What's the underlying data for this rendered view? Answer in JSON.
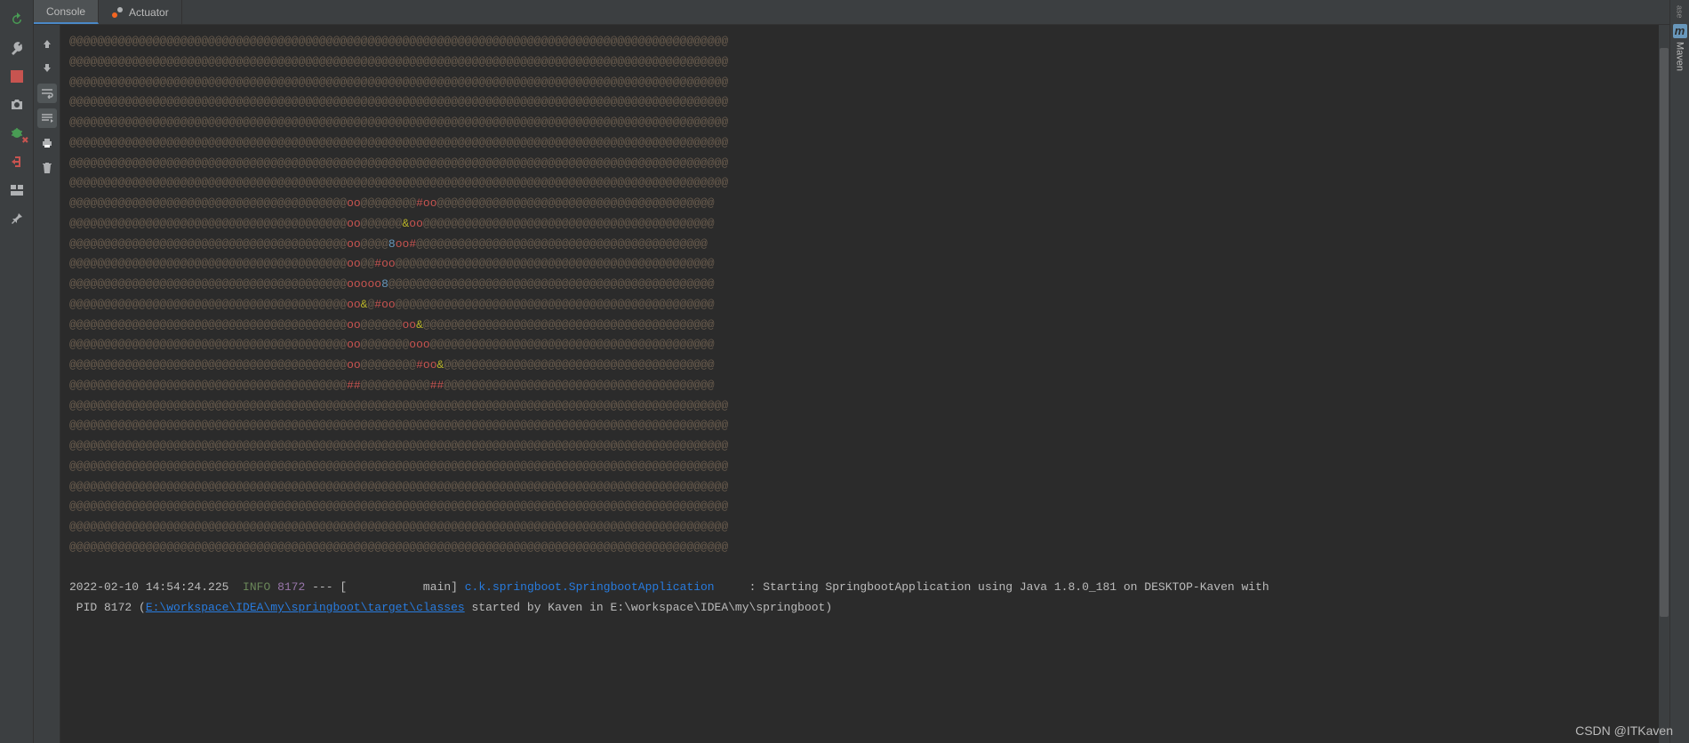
{
  "tabs": {
    "console": "Console",
    "actuator": "Actuator"
  },
  "right_sidebar": {
    "maven": "Maven",
    "small": "ase"
  },
  "log": {
    "timestamp": "2022-02-10 14:54:24.225",
    "level": "INFO",
    "pid": "8172",
    "sep": "--- [",
    "thread": "           main]",
    "logger": "c.k.springboot.SpringbootApplication",
    "colon": "     : ",
    "msg1": "Starting SpringbootApplication using Java 1.8.0_181 on DESKTOP-Kaven with",
    "msg2a": " PID 8172 (",
    "link": "E:\\workspace\\IDEA\\my\\springboot\\target\\classes",
    "msg2b": " started by Kaven in E:\\workspace\\IDEA\\my\\springboot)"
  },
  "banner": {
    "plain_row": "@@@@@@@@@@@@@@@@@@@@@@@@@@@@@@@@@@@@@@@@@@@@@@@@@@@@@@@@@@@@@@@@@@@@@@@@@@@@@@@@@@@@@@@@@@@@@@@",
    "colored": [
      {
        "pre": "@@@@@@@@@@@@@@@@@@@@@@@@@@@@@@@@@@@@@@@@",
        "seq": [
          {
            "t": "oo",
            "c": "oo"
          },
          {
            "t": "ba",
            "c": "@@@@@@@@"
          },
          {
            "t": "hash",
            "c": "#"
          },
          {
            "t": "oo",
            "c": "oo"
          }
        ],
        "post": "@@@@@@@@@@@@@@@@@@@@@@@@@@@@@@@@@@@@@@@@"
      },
      {
        "pre": "@@@@@@@@@@@@@@@@@@@@@@@@@@@@@@@@@@@@@@@@",
        "seq": [
          {
            "t": "oo",
            "c": "oo"
          },
          {
            "t": "ba",
            "c": "@@@@@@"
          },
          {
            "t": "amp",
            "c": "&"
          },
          {
            "t": "oo",
            "c": "oo"
          }
        ],
        "post": "@@@@@@@@@@@@@@@@@@@@@@@@@@@@@@@@@@@@@@@@@@"
      },
      {
        "pre": "@@@@@@@@@@@@@@@@@@@@@@@@@@@@@@@@@@@@@@@@",
        "seq": [
          {
            "t": "oo",
            "c": "oo"
          },
          {
            "t": "ba",
            "c": "@@@@"
          },
          {
            "t": "num",
            "c": "8"
          },
          {
            "t": "oo",
            "c": "oo"
          },
          {
            "t": "hash",
            "c": "#"
          }
        ],
        "post": "@@@@@@@@@@@@@@@@@@@@@@@@@@@@@@@@@@@@@@@@@@"
      },
      {
        "pre": "@@@@@@@@@@@@@@@@@@@@@@@@@@@@@@@@@@@@@@@@",
        "seq": [
          {
            "t": "oo",
            "c": "oo"
          },
          {
            "t": "ba",
            "c": "@@"
          },
          {
            "t": "hash",
            "c": "#"
          },
          {
            "t": "oo",
            "c": "oo"
          }
        ],
        "post": "@@@@@@@@@@@@@@@@@@@@@@@@@@@@@@@@@@@@@@@@@@@@@@"
      },
      {
        "pre": "@@@@@@@@@@@@@@@@@@@@@@@@@@@@@@@@@@@@@@@@",
        "seq": [
          {
            "t": "oo",
            "c": "ooooo"
          },
          {
            "t": "num",
            "c": "8"
          }
        ],
        "post": "@@@@@@@@@@@@@@@@@@@@@@@@@@@@@@@@@@@@@@@@@@@@@@@"
      },
      {
        "pre": "@@@@@@@@@@@@@@@@@@@@@@@@@@@@@@@@@@@@@@@@",
        "seq": [
          {
            "t": "oo",
            "c": "oo"
          },
          {
            "t": "amp",
            "c": "&"
          },
          {
            "t": "ba",
            "c": "@"
          },
          {
            "t": "hash",
            "c": "#"
          },
          {
            "t": "oo",
            "c": "oo"
          }
        ],
        "post": "@@@@@@@@@@@@@@@@@@@@@@@@@@@@@@@@@@@@@@@@@@@@@@"
      },
      {
        "pre": "@@@@@@@@@@@@@@@@@@@@@@@@@@@@@@@@@@@@@@@@",
        "seq": [
          {
            "t": "oo",
            "c": "oo"
          },
          {
            "t": "ba",
            "c": "@@@@@@"
          },
          {
            "t": "oo",
            "c": "oo"
          },
          {
            "t": "amp",
            "c": "&"
          }
        ],
        "post": "@@@@@@@@@@@@@@@@@@@@@@@@@@@@@@@@@@@@@@@@@@"
      },
      {
        "pre": "@@@@@@@@@@@@@@@@@@@@@@@@@@@@@@@@@@@@@@@@",
        "seq": [
          {
            "t": "oo",
            "c": "oo"
          },
          {
            "t": "ba",
            "c": "@@@@@@@"
          },
          {
            "t": "oo",
            "c": "ooo"
          }
        ],
        "post": "@@@@@@@@@@@@@@@@@@@@@@@@@@@@@@@@@@@@@@@@@"
      },
      {
        "pre": "@@@@@@@@@@@@@@@@@@@@@@@@@@@@@@@@@@@@@@@@",
        "seq": [
          {
            "t": "oo",
            "c": "oo"
          },
          {
            "t": "ba",
            "c": "@@@@@@@@"
          },
          {
            "t": "hash",
            "c": "#"
          },
          {
            "t": "oo",
            "c": "oo"
          },
          {
            "t": "amp",
            "c": "&"
          }
        ],
        "post": "@@@@@@@@@@@@@@@@@@@@@@@@@@@@@@@@@@@@@@@"
      },
      {
        "pre": "@@@@@@@@@@@@@@@@@@@@@@@@@@@@@@@@@@@@@@@@",
        "seq": [
          {
            "t": "hash",
            "c": "##"
          },
          {
            "t": "ba",
            "c": "@@@@@@@@@@"
          },
          {
            "t": "hash",
            "c": "##"
          }
        ],
        "post": "@@@@@@@@@@@@@@@@@@@@@@@@@@@@@@@@@@@@@@@"
      }
    ]
  },
  "watermark": "CSDN @ITKaven"
}
